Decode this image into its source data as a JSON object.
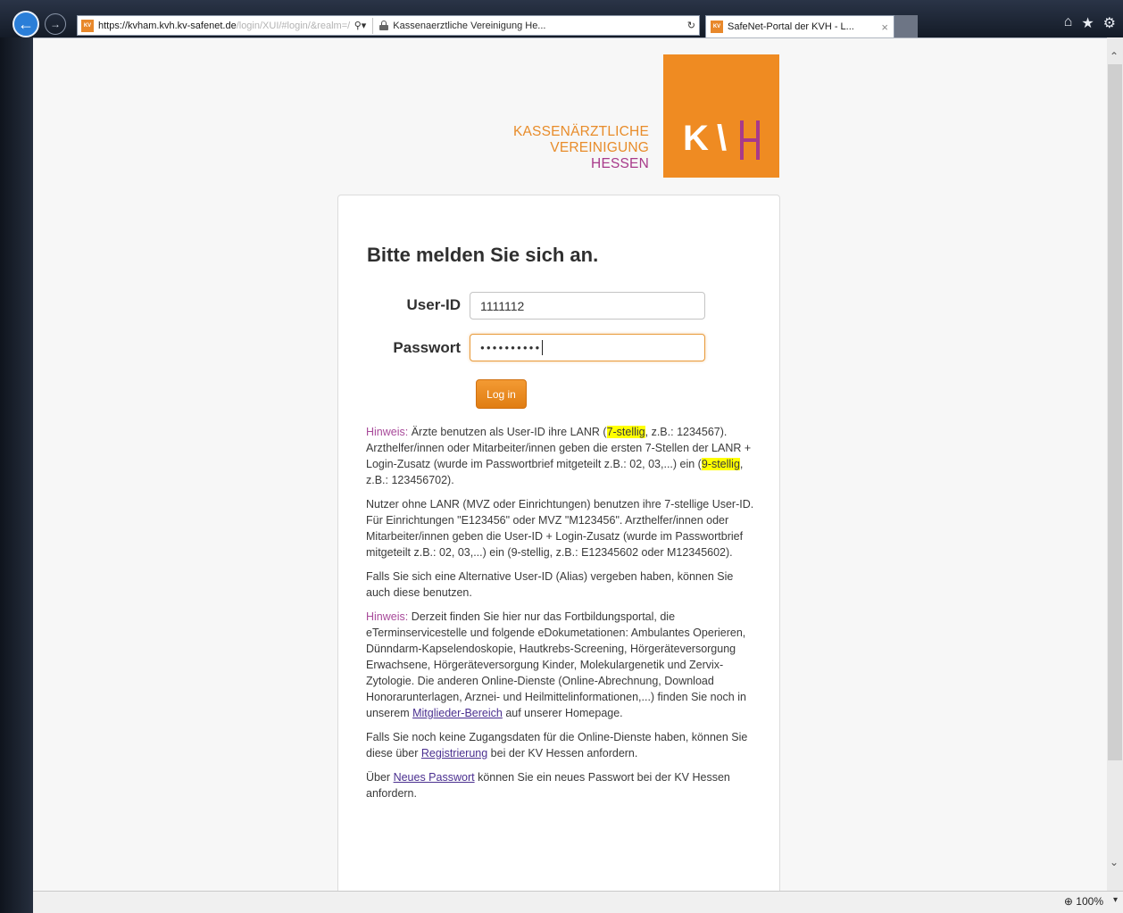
{
  "browser": {
    "url_host": "https://kvham.kvh.kv-safenet.de",
    "url_path": "/login/XUI/#login/&realm=/KVH&forw",
    "favicon_text": "KV",
    "search_icon": "search-icon",
    "dropdown_icon": "chevron-down-icon",
    "cert_text": "Kassenaerztliche Vereinigung He...",
    "refresh_icon": "refresh-icon",
    "tab_title": "SafeNet-Portal der KVH - L...",
    "tab_close": "×",
    "toolbar_icons": [
      "home-icon",
      "star-icon",
      "gear-icon"
    ],
    "zoom": "100%"
  },
  "logo": {
    "line1": "KASSENÄRZTLICHE",
    "line2": "VEREINIGUNG",
    "line3": "HESSEN",
    "mark_k": "K",
    "mark_slash": "\\",
    "colors": {
      "orange": "#ef8b22",
      "purple": "#a83a8a"
    }
  },
  "form": {
    "heading": "Bitte melden Sie sich an.",
    "userid_label": "User-ID",
    "userid_value": "1111112",
    "password_label": "Passwort",
    "password_value": "●●●●●●●●●●",
    "login_button": "Log in"
  },
  "info": {
    "p1_hint": "Hinweis:",
    "p1_a": " Ärzte benutzen als User-ID ihre LANR (",
    "p1_hl1": "7-stellig",
    "p1_b": ", z.B.: 1234567). Arzthelfer/innen oder Mitarbeiter/innen geben die ersten 7-Stellen der LANR + Login-Zusatz (wurde im Passwortbrief mitgeteilt z.B.: 02, 03,...) ein (",
    "p1_hl2": "9-stellig",
    "p1_c": ", z.B.: 123456702).",
    "p2": "Nutzer ohne LANR (MVZ oder Einrichtungen) benutzen ihre 7-stellige User-ID. Für Einrichtungen \"E123456\" oder MVZ \"M123456\". Arzthelfer/innen oder Mitarbeiter/innen geben die User-ID + Login-Zusatz (wurde im Passwortbrief mitgeteilt z.B.: 02, 03,...) ein (9-stellig, z.B.: E12345602 oder M12345602).",
    "p3": "Falls Sie sich eine Alternative User-ID (Alias) vergeben haben, können Sie auch diese benutzen.",
    "p4_hint": "Hinweis:",
    "p4_a": " Derzeit finden Sie hier nur das Fortbildungsportal, die eTerminservicestelle und folgende eDokumetationen: Ambulantes Operieren, Dünndarm-Kapselendoskopie, Hautkrebs-Screening, Hörgeräteversorgung Erwachsene, Hörgeräteversorgung Kinder, Molekulargenetik und Zervix-Zytologie. Die anderen Online-Dienste (Online-Abrechnung, Download Honorarunterlagen, Arznei- und Heilmittelinformationen,...) finden Sie noch in unserem ",
    "p4_link": "Mitglieder-Bereich",
    "p4_b": " auf unserer Homepage.",
    "p5_a": "Falls Sie noch keine Zugangsdaten für die Online-Dienste haben, können Sie diese über ",
    "p5_link": "Registrierung",
    "p5_b": " bei der KV Hessen anfordern.",
    "p6_a": "Über ",
    "p6_link": "Neues Passwort",
    "p6_b": " können Sie ein neues Passwort bei der KV Hessen anfordern."
  }
}
